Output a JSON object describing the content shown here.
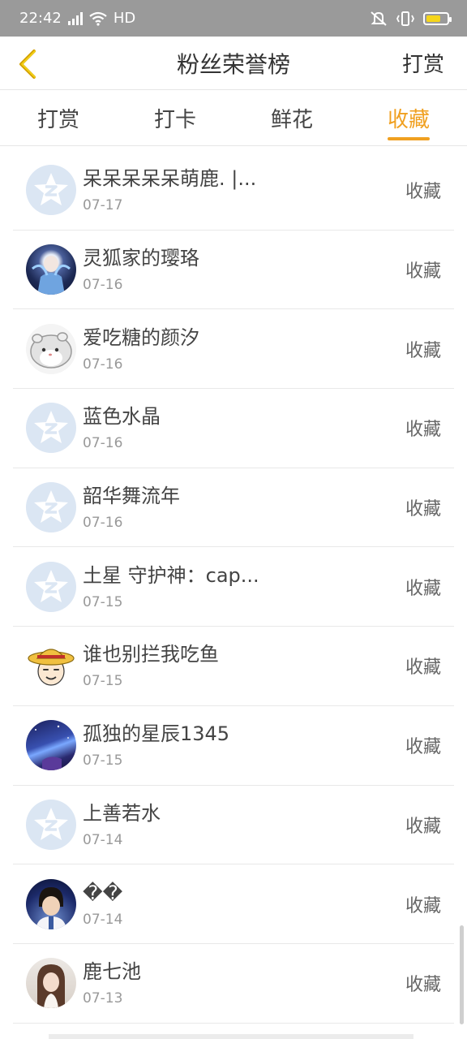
{
  "status": {
    "time": "22:42",
    "network": "4G",
    "hd": "HD"
  },
  "header": {
    "title": "粉丝荣誉榜",
    "action_label": "打赏"
  },
  "tabs": [
    {
      "label": "打赏",
      "active": false
    },
    {
      "label": "打卡",
      "active": false
    },
    {
      "label": "鲜花",
      "active": false
    },
    {
      "label": "收藏",
      "active": true
    }
  ],
  "accent_color": "#f0a020",
  "fans": [
    {
      "name": "呆呆呆呆呆萌鹿. |...",
      "date": "07-17",
      "action": "收藏",
      "avatar": "default"
    },
    {
      "name": "灵狐家的璎珞",
      "date": "07-16",
      "action": "收藏",
      "avatar": "anime-girl-blue"
    },
    {
      "name": "爱吃糖的颜汐",
      "date": "07-16",
      "action": "收藏",
      "avatar": "hamster"
    },
    {
      "name": "蓝色水晶",
      "date": "07-16",
      "action": "收藏",
      "avatar": "default"
    },
    {
      "name": "韶华舞流年",
      "date": "07-16",
      "action": "收藏",
      "avatar": "default"
    },
    {
      "name": "土星 守护神：cap...",
      "date": "07-15",
      "action": "收藏",
      "avatar": "default"
    },
    {
      "name": "谁也别拦我吃鱼",
      "date": "07-15",
      "action": "收藏",
      "avatar": "luffy"
    },
    {
      "name": "孤独的星辰1345",
      "date": "07-15",
      "action": "收藏",
      "avatar": "night-sky"
    },
    {
      "name": "上善若水",
      "date": "07-14",
      "action": "收藏",
      "avatar": "default"
    },
    {
      "name": "��",
      "date": "07-14",
      "action": "收藏",
      "avatar": "boy-photo"
    },
    {
      "name": "鹿七池",
      "date": "07-13",
      "action": "收藏",
      "avatar": "girl-photo"
    }
  ]
}
